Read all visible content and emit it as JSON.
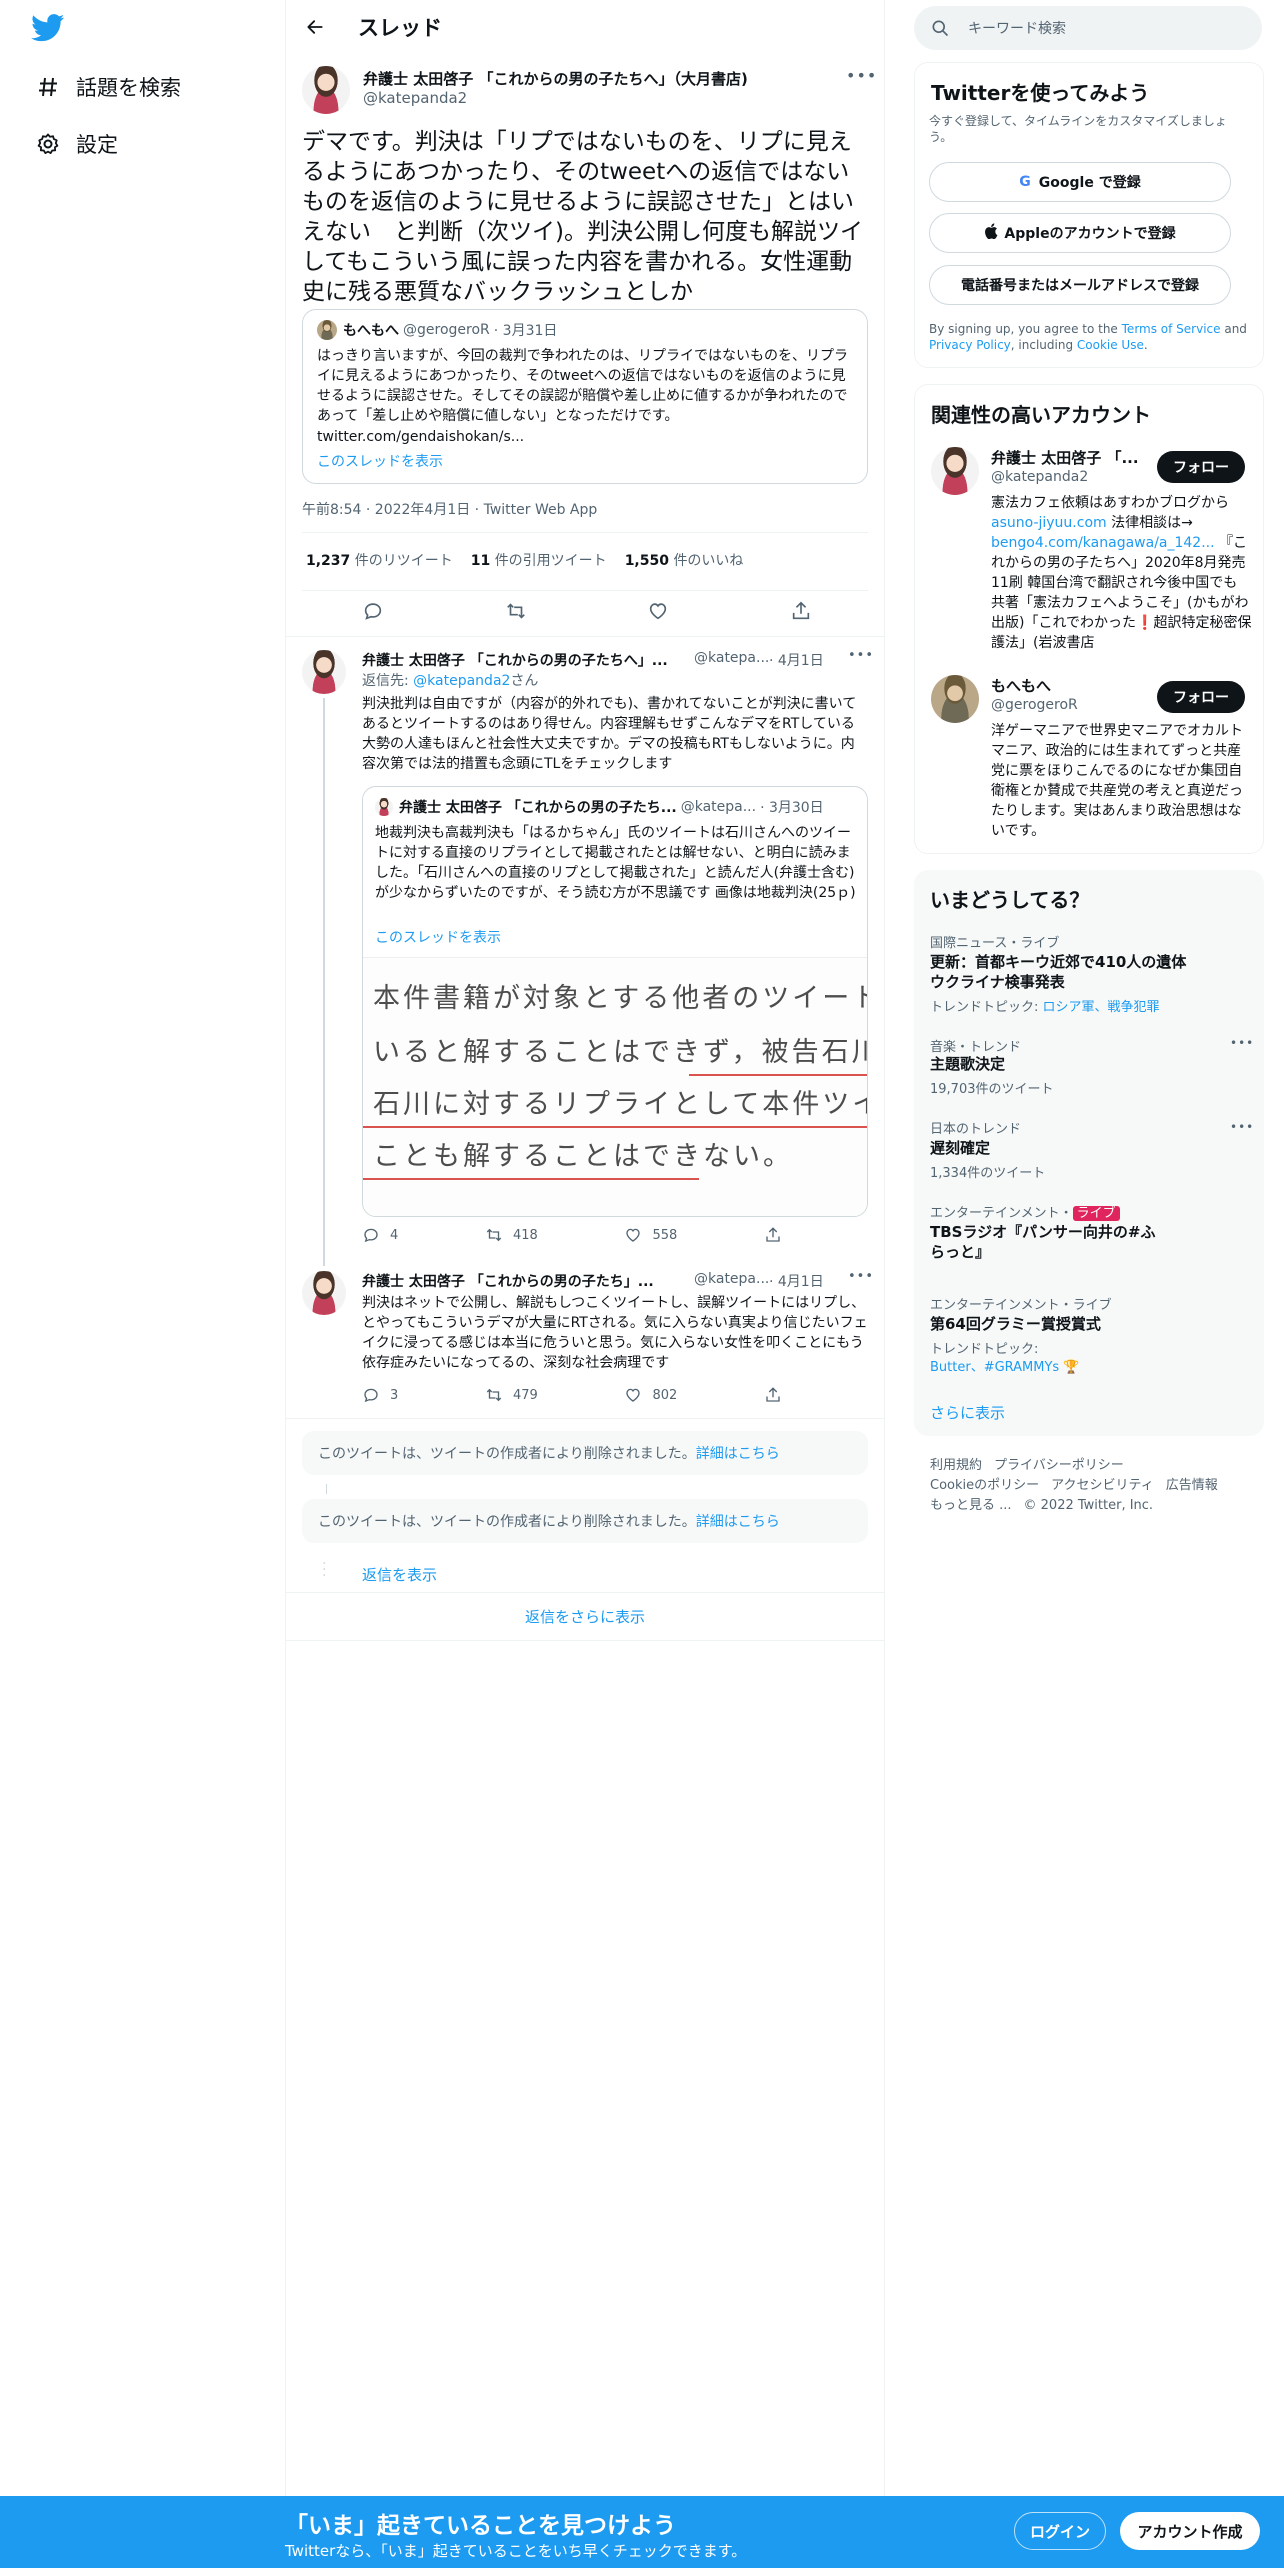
{
  "nav": {
    "items": [
      {
        "label": "話題を検索",
        "icon": "hashtag-icon"
      },
      {
        "label": "設定",
        "icon": "gear-icon"
      }
    ]
  },
  "header": {
    "title": "スレッド"
  },
  "main_tweet": {
    "display_name": "弁護士 太田啓子 「これからの男の子たちへ」（大月書店)",
    "handle": "@katepanda2",
    "text": "デマです。判決は「リプではないものを、リプに見えるようにあつかったり、そのtweetへの返信ではないものを返信のように見せるように誤認させた」とはいえない　と判断（次ツイ)。判決公開し何度も解説ツイしてもこういう風に誤った内容を書かれる。女性運動史に残る悪質なバックラッシュとしか",
    "quote": {
      "display_name": "もへもへ",
      "handle": "@gerogeroR",
      "date": "· 3月31日",
      "text": "はっきり言いますが、今回の裁判で争われたのは、リプライではないものを、リプライに見えるようにあつかったり、そのtweetへの返信ではないものを返信のように見せるように誤認させた。そしてその誤認が賠償や差し止めに値するかが争われたのであって「差し止めや賠償に値しない」となっただけです。",
      "link": "twitter.com/gendaishokan/s...",
      "show_thread": "このスレッドを表示"
    },
    "meta": "午前8:54 · 2022年4月1日 · Twitter Web App",
    "stats": [
      {
        "num": "1,237",
        "label": "件のリツイート"
      },
      {
        "num": "11",
        "label": "件の引用ツイート"
      },
      {
        "num": "1,550",
        "label": "件のいいね"
      }
    ]
  },
  "reply1": {
    "display_name": "弁護士 太田啓子 「これからの男の子たちへ」...",
    "handle": "@katepa...",
    "date": "· 4月1日",
    "reply_to_prefix": "返信先: ",
    "reply_to_handle": "@katepanda2",
    "reply_to_suffix": "さん",
    "text": "判決批判は自由ですが（内容が的外れでも)、書かれてないことが判決に書いてあるとツイートするのはあり得せん。内容理解もせずこんなデマをRTしている大勢の人達もほんと社会性大丈夫ですか。デマの投稿もRTもしないように。内容次第では法的措置も念頭にTLをチェックします",
    "quote": {
      "display_name": "弁護士 太田啓子 「これからの男の子たち...",
      "handle": "@katepa...",
      "date": "· 3月30日",
      "text": "地裁判決も高裁判決も「はるかちゃん」氏のツイートは石川さんへのツイートに対する直接のリプライとして掲載されたとは解せない、と明白に読みました。「石川さんへの直接のリプとして掲載された」と読んだ人(弁護士含む)が少なからずいたのですが、そう読む方が不思議です 画像は地裁判決(25ｐ)",
      "show_thread": "このスレッドを表示",
      "image_lines": [
        "本件書籍が対象とする他者のツイートが被",
        "いると解することはできず，被告石川が，本",
        "石川に対するリプライとして本件ツイートが",
        "ことも解することはできない。"
      ]
    },
    "actions": {
      "reply": "4",
      "retweet": "418",
      "like": "558"
    }
  },
  "reply2": {
    "display_name": "弁護士 太田啓子 「これからの男の子たち」...",
    "handle": "@katepa...",
    "date": "· 4月1日",
    "text": "判決はネットで公開し、解説もしつこくツイートし、誤解ツイートにはリプし、とやってもこういうデマが大量にRTされる。気に入らない真実より信じたいフェイクに浸ってる感じは本当に危ういと思う。気に入らない女性を叩くことにもう依存症みたいになってるの、深刻な社会病理です",
    "actions": {
      "reply": "3",
      "retweet": "479",
      "like": "802"
    }
  },
  "deleted_text": "このツイートは、ツイートの作成者により削除されました。",
  "deleted_link": "詳細はこちら",
  "show_replies": "返信を表示",
  "more_replies": "返信をさらに表示",
  "right": {
    "search_placeholder": "キーワード検索",
    "signup": {
      "title": "Twitterを使ってみよう",
      "subtitle": "今すぐ登録して、タイムラインをカスタマイズしましょう。",
      "google": "Google で登録",
      "apple": "Appleのアカウントで登録",
      "phone": "電話番号またはメールアドレスで登録",
      "terms_1": "By signing up, you agree to the ",
      "terms_link_1": "Terms of Service",
      "terms_2": " and ",
      "terms_link_2": "Privacy Policy",
      "terms_3": ", including ",
      "terms_link_3": "Cookie Use",
      "terms_4": "."
    },
    "related": {
      "title": "関連性の高いアカウント",
      "follow_label": "フォロー",
      "accounts": [
        {
          "name": "弁護士 太田啓子 「...",
          "handle": "@katepanda2",
          "bio_1": "憲法カフェ依頼はあすわかブログから ",
          "bio_link_1": "asuno-jiyuu.com",
          "bio_2": " 法律相談は→ ",
          "bio_link_2": "bengo4.com/kanagawa/a_142...",
          "bio_3": " 『これからの男の子たちへ」2020年8月発売 11刷 韓国台湾で翻訳され今後中国でも 共著「憲法カフェへようこそ」(かもがわ出版)「これでわかった",
          "bio_emoji": "❗",
          "bio_4": "超訳特定秘密保護法」(岩波書店"
        },
        {
          "name": "もへもへ",
          "handle": "@gerogeroR",
          "bio_1": "洋ゲーマニアで世界史マニアでオカルトマニア、政治的には生まれてずっと共産党に票をほりこんでるのになぜか集団自衛権とか賛成で共産党の考えと真逆だったりします。実はあんまり政治思想はないです。"
        }
      ]
    },
    "trends": {
      "title": "いまどうしてる？",
      "items": [
        {
          "category": "国際ニュース・ライブ",
          "title": "更新：首都キーウ近郊で410人の遺体 ウクライナ検事発表",
          "sub_prefix": "トレンドトピック: ",
          "sub_links": "ロシア軍、戦争犯罪"
        },
        {
          "category": "音楽・トレンド",
          "title": "主題歌決定",
          "count": "19,703件のツイート"
        },
        {
          "category": "日本のトレンド",
          "title": "遅刻確定",
          "count": "1,334件のツイート"
        },
        {
          "category": "エンターテインメント・",
          "live": "ライブ",
          "title": "TBSラジオ『パンサー向井の#ふらっと』"
        },
        {
          "category": "エンターテインメント・ライブ",
          "title": "第64回グラミー賞授賞式",
          "sub_prefix": "トレンドトピック:",
          "sub_links": "Butter、#GRAMMYs"
        }
      ],
      "more": "さらに表示"
    },
    "footer": {
      "links_row1": [
        "利用規約",
        "プライバシーポリシー"
      ],
      "links_row2": [
        "Cookieのポリシー",
        "アクセシビリティ",
        "広告情報"
      ],
      "more": "もっと見る ...",
      "copyright": "© 2022 Twitter, Inc."
    }
  },
  "bottom_bar": {
    "title": "「いま」起きていることを見つけよう",
    "subtitle": "Twitterなら、「いま」起きていることをいち早くチェックできます。",
    "login": "ログイン",
    "signup": "アカウント作成"
  },
  "colors": {
    "accent": "#1d9bf0",
    "text": "#0f1419",
    "muted": "#536471",
    "live_badge": "#e0245e"
  }
}
